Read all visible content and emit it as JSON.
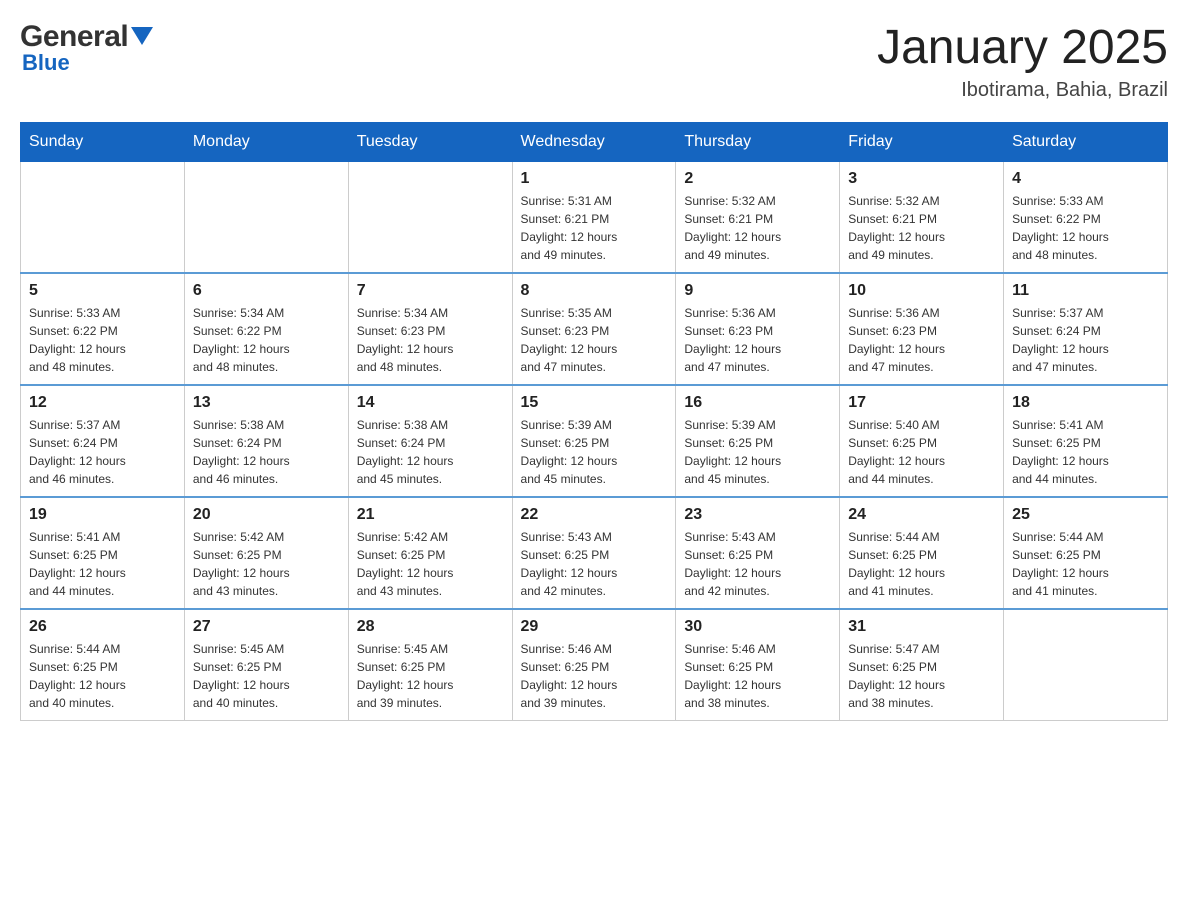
{
  "header": {
    "logo_general": "General",
    "logo_blue": "Blue",
    "month_title": "January 2025",
    "location": "Ibotirama, Bahia, Brazil"
  },
  "weekdays": [
    "Sunday",
    "Monday",
    "Tuesday",
    "Wednesday",
    "Thursday",
    "Friday",
    "Saturday"
  ],
  "weeks": [
    [
      {
        "day": "",
        "info": ""
      },
      {
        "day": "",
        "info": ""
      },
      {
        "day": "",
        "info": ""
      },
      {
        "day": "1",
        "info": "Sunrise: 5:31 AM\nSunset: 6:21 PM\nDaylight: 12 hours\nand 49 minutes."
      },
      {
        "day": "2",
        "info": "Sunrise: 5:32 AM\nSunset: 6:21 PM\nDaylight: 12 hours\nand 49 minutes."
      },
      {
        "day": "3",
        "info": "Sunrise: 5:32 AM\nSunset: 6:21 PM\nDaylight: 12 hours\nand 49 minutes."
      },
      {
        "day": "4",
        "info": "Sunrise: 5:33 AM\nSunset: 6:22 PM\nDaylight: 12 hours\nand 48 minutes."
      }
    ],
    [
      {
        "day": "5",
        "info": "Sunrise: 5:33 AM\nSunset: 6:22 PM\nDaylight: 12 hours\nand 48 minutes."
      },
      {
        "day": "6",
        "info": "Sunrise: 5:34 AM\nSunset: 6:22 PM\nDaylight: 12 hours\nand 48 minutes."
      },
      {
        "day": "7",
        "info": "Sunrise: 5:34 AM\nSunset: 6:23 PM\nDaylight: 12 hours\nand 48 minutes."
      },
      {
        "day": "8",
        "info": "Sunrise: 5:35 AM\nSunset: 6:23 PM\nDaylight: 12 hours\nand 47 minutes."
      },
      {
        "day": "9",
        "info": "Sunrise: 5:36 AM\nSunset: 6:23 PM\nDaylight: 12 hours\nand 47 minutes."
      },
      {
        "day": "10",
        "info": "Sunrise: 5:36 AM\nSunset: 6:23 PM\nDaylight: 12 hours\nand 47 minutes."
      },
      {
        "day": "11",
        "info": "Sunrise: 5:37 AM\nSunset: 6:24 PM\nDaylight: 12 hours\nand 47 minutes."
      }
    ],
    [
      {
        "day": "12",
        "info": "Sunrise: 5:37 AM\nSunset: 6:24 PM\nDaylight: 12 hours\nand 46 minutes."
      },
      {
        "day": "13",
        "info": "Sunrise: 5:38 AM\nSunset: 6:24 PM\nDaylight: 12 hours\nand 46 minutes."
      },
      {
        "day": "14",
        "info": "Sunrise: 5:38 AM\nSunset: 6:24 PM\nDaylight: 12 hours\nand 45 minutes."
      },
      {
        "day": "15",
        "info": "Sunrise: 5:39 AM\nSunset: 6:25 PM\nDaylight: 12 hours\nand 45 minutes."
      },
      {
        "day": "16",
        "info": "Sunrise: 5:39 AM\nSunset: 6:25 PM\nDaylight: 12 hours\nand 45 minutes."
      },
      {
        "day": "17",
        "info": "Sunrise: 5:40 AM\nSunset: 6:25 PM\nDaylight: 12 hours\nand 44 minutes."
      },
      {
        "day": "18",
        "info": "Sunrise: 5:41 AM\nSunset: 6:25 PM\nDaylight: 12 hours\nand 44 minutes."
      }
    ],
    [
      {
        "day": "19",
        "info": "Sunrise: 5:41 AM\nSunset: 6:25 PM\nDaylight: 12 hours\nand 44 minutes."
      },
      {
        "day": "20",
        "info": "Sunrise: 5:42 AM\nSunset: 6:25 PM\nDaylight: 12 hours\nand 43 minutes."
      },
      {
        "day": "21",
        "info": "Sunrise: 5:42 AM\nSunset: 6:25 PM\nDaylight: 12 hours\nand 43 minutes."
      },
      {
        "day": "22",
        "info": "Sunrise: 5:43 AM\nSunset: 6:25 PM\nDaylight: 12 hours\nand 42 minutes."
      },
      {
        "day": "23",
        "info": "Sunrise: 5:43 AM\nSunset: 6:25 PM\nDaylight: 12 hours\nand 42 minutes."
      },
      {
        "day": "24",
        "info": "Sunrise: 5:44 AM\nSunset: 6:25 PM\nDaylight: 12 hours\nand 41 minutes."
      },
      {
        "day": "25",
        "info": "Sunrise: 5:44 AM\nSunset: 6:25 PM\nDaylight: 12 hours\nand 41 minutes."
      }
    ],
    [
      {
        "day": "26",
        "info": "Sunrise: 5:44 AM\nSunset: 6:25 PM\nDaylight: 12 hours\nand 40 minutes."
      },
      {
        "day": "27",
        "info": "Sunrise: 5:45 AM\nSunset: 6:25 PM\nDaylight: 12 hours\nand 40 minutes."
      },
      {
        "day": "28",
        "info": "Sunrise: 5:45 AM\nSunset: 6:25 PM\nDaylight: 12 hours\nand 39 minutes."
      },
      {
        "day": "29",
        "info": "Sunrise: 5:46 AM\nSunset: 6:25 PM\nDaylight: 12 hours\nand 39 minutes."
      },
      {
        "day": "30",
        "info": "Sunrise: 5:46 AM\nSunset: 6:25 PM\nDaylight: 12 hours\nand 38 minutes."
      },
      {
        "day": "31",
        "info": "Sunrise: 5:47 AM\nSunset: 6:25 PM\nDaylight: 12 hours\nand 38 minutes."
      },
      {
        "day": "",
        "info": ""
      }
    ]
  ]
}
